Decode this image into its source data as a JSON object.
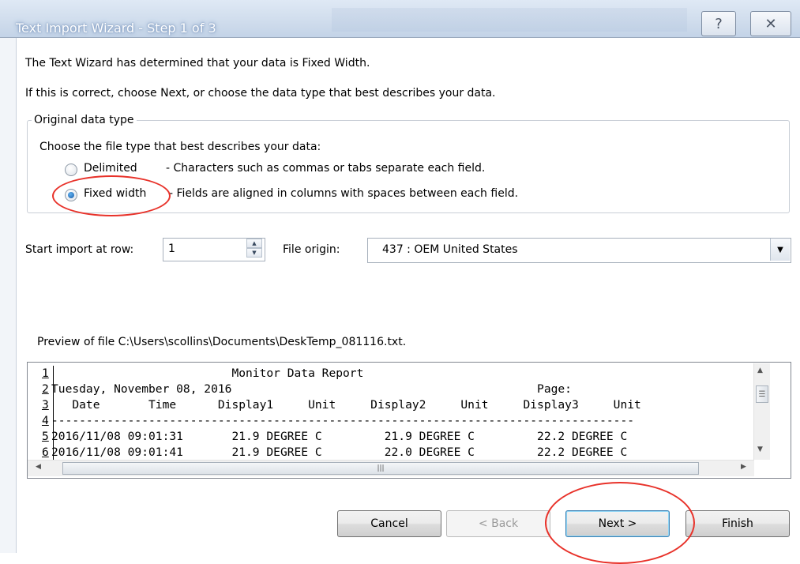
{
  "window": {
    "title": "Text Import Wizard - Step 1 of 3",
    "help_glyph": "?",
    "close_glyph": "✕"
  },
  "intro": {
    "line1": "The Text Wizard has determined that your data is Fixed Width.",
    "line2": "If this is correct, choose Next, or choose the data type that best describes your data."
  },
  "original_data_type": {
    "legend": "Original data type",
    "prompt": "Choose the file type that best describes your data:",
    "options": [
      {
        "label": "Delimited",
        "description": "- Characters such as commas or tabs separate each field.",
        "checked": false
      },
      {
        "label": "Fixed width",
        "description": "- Fields are aligned in columns with spaces between each field.",
        "checked": true
      }
    ]
  },
  "start_row": {
    "label": "Start import at row:",
    "value": "1"
  },
  "file_origin": {
    "label": "File origin:",
    "value": "437 : OEM United States"
  },
  "preview": {
    "caption": "Preview of file C:\\Users\\scollins\\Documents\\DeskTemp_081116.txt.",
    "rows": [
      {
        "num": "1",
        "text": "                          Monitor Data Report"
      },
      {
        "num": "2",
        "text": "Tuesday, November 08, 2016                                            Page:"
      },
      {
        "num": "3",
        "text": "   Date       Time      Display1     Unit     Display2     Unit     Display3     Unit"
      },
      {
        "num": "4",
        "text": "------------------------------------------------------------------------------------"
      },
      {
        "num": "5",
        "text": "2016/11/08 09:01:31       21.9 DEGREE C         21.9 DEGREE C         22.2 DEGREE C"
      },
      {
        "num": "6",
        "text": "2016/11/08 09:01:41       21.9 DEGREE C         22.0 DEGREE C         22.2 DEGREE C"
      }
    ]
  },
  "buttons": {
    "cancel": "Cancel",
    "back": "< Back",
    "next": "Next >",
    "finish": "Finish"
  },
  "colors": {
    "annotation": "#e8322a",
    "accent": "#1a5da8"
  }
}
